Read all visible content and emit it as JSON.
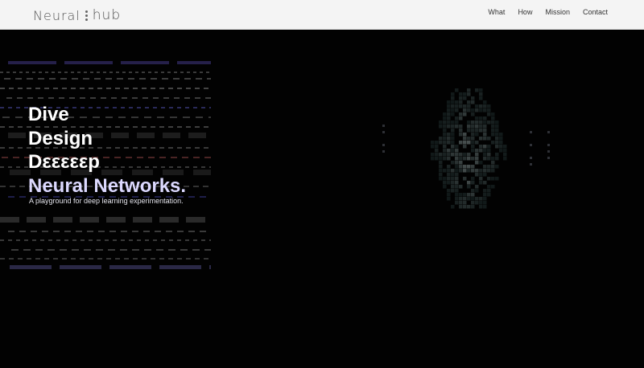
{
  "brand": {
    "word1": "Neural",
    "word2": "hub"
  },
  "nav": {
    "items": [
      {
        "label": "What"
      },
      {
        "label": "How"
      },
      {
        "label": "Mission"
      },
      {
        "label": "Contact"
      }
    ]
  },
  "hero": {
    "headline": [
      "Dive",
      "Design",
      "Dεεεεεp",
      "Neural Networks."
    ],
    "tagline": "A playground for deep learning experimentation."
  },
  "colors": {
    "background": "#000000",
    "navbar": "#f4f4f4",
    "headline": "#ffffff",
    "headline_accent": "#dcd9ff"
  }
}
